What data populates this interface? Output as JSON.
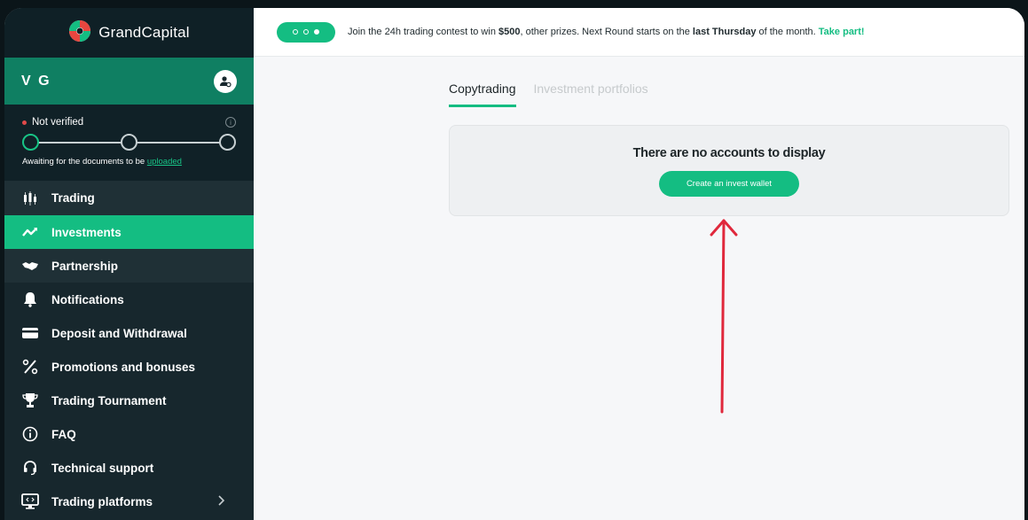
{
  "brand": {
    "name": "GrandCapital"
  },
  "user": {
    "initials": "V G",
    "icon": "user-settings-icon"
  },
  "verification": {
    "status": "Not verified",
    "note_prefix": "Awaiting for the documents to be ",
    "note_link": "uploaded",
    "steps_total": 3,
    "steps_done": 1
  },
  "sidebar": {
    "items": [
      {
        "label": "Trading",
        "icon": "candles-icon"
      },
      {
        "label": "Investments",
        "icon": "chart-trend-icon"
      },
      {
        "label": "Partnership",
        "icon": "handshake-icon"
      },
      {
        "label": "Notifications",
        "icon": "bell-icon"
      },
      {
        "label": "Deposit and Withdrawal",
        "icon": "card-icon"
      },
      {
        "label": "Promotions and bonuses",
        "icon": "percent-icon"
      },
      {
        "label": "Trading Tournament",
        "icon": "trophy-icon"
      },
      {
        "label": "FAQ",
        "icon": "info-icon"
      },
      {
        "label": "Technical support",
        "icon": "headset-icon"
      },
      {
        "label": "Trading platforms",
        "icon": "monitor-icon"
      }
    ]
  },
  "banner": {
    "text1": "Join the 24h trading contest to win ",
    "prize": "$500",
    "text2": ", other prizes. Next Round starts on the ",
    "day": "last Thursday",
    "text3": " of the month. ",
    "cta": "Take part!"
  },
  "tabs": [
    {
      "label": "Copytrading",
      "active": true
    },
    {
      "label": "Investment portfolios",
      "active": false
    }
  ],
  "panel": {
    "title": "There are no accounts to display",
    "button": "Create an invest wallet"
  },
  "colors": {
    "accent": "#14bd82",
    "sidebar": "#17272d",
    "annotation_arrow": "#e0283c"
  }
}
